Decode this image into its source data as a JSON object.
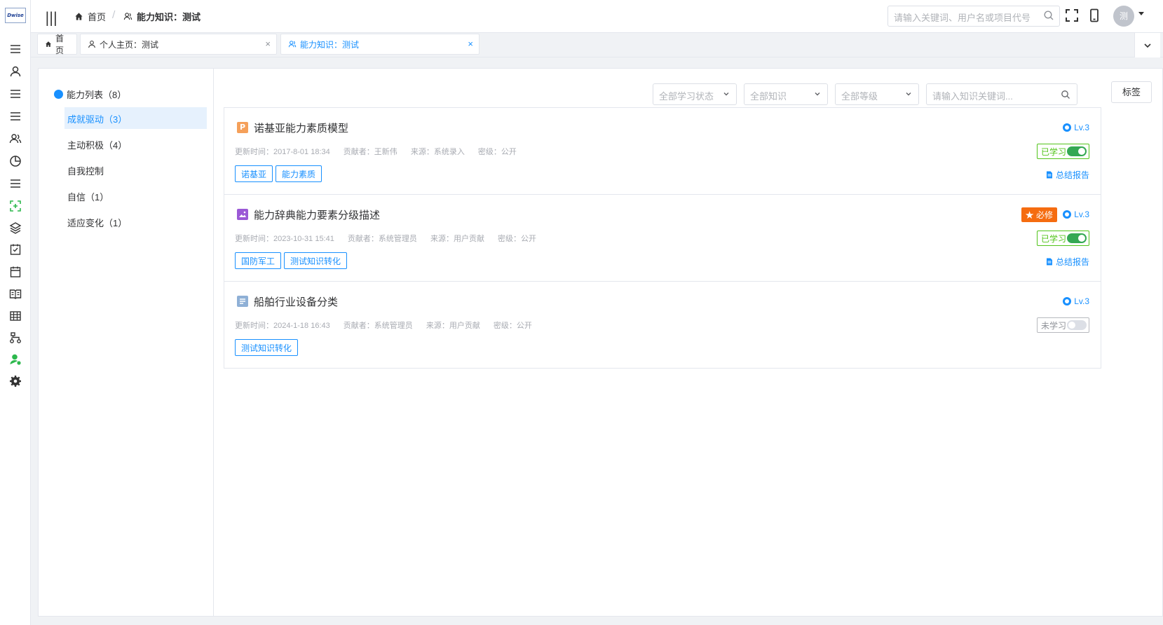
{
  "app": {
    "logo": "Dwise"
  },
  "header": {
    "breadcrumb_home": "首页",
    "breadcrumb_sep": "/",
    "breadcrumb_current": "能力知识：测试",
    "search_placeholder": "请输入关键词、用户名或项目代号",
    "avatar_text": "测"
  },
  "tabs": [
    {
      "label": "首页",
      "icon": "home-icon"
    },
    {
      "label": "个人主页：测试",
      "icon": "user-icon",
      "close": "×"
    },
    {
      "label": "能力知识：测试",
      "icon": "users-icon",
      "close": "×",
      "active": true
    }
  ],
  "sidebar": {
    "root": "能力列表（8）",
    "items": [
      {
        "label": "成就驱动（3）",
        "selected": true
      },
      {
        "label": "主动积极（4）"
      },
      {
        "label": "自我控制"
      },
      {
        "label": "自信（1）"
      },
      {
        "label": "适应变化（1）"
      }
    ]
  },
  "filters": {
    "study_status": "全部学习状态",
    "knowledge": "全部知识",
    "level": "全部等级",
    "keyword_placeholder": "请输入知识关键词...",
    "tag_button": "标签"
  },
  "cards": [
    {
      "icon_letter": "P",
      "icon_color": "#f5a05a",
      "title": "诺基亚能力素质模型",
      "update_time": "更新时间：2017-8-01 18:34",
      "contributor": "贡献者：王新伟",
      "source": "来源：系统录入",
      "secrecy": "密级：公开",
      "tags": [
        "诺基亚",
        "能力素质"
      ],
      "level": "Lv.3",
      "status": "已学习",
      "learned": true,
      "report": "总结报告"
    },
    {
      "icon_color": "#9b59d6",
      "title": "能力辞典能力要素分级描述",
      "update_time": "更新时间：2023-10-31 15:41",
      "contributor": "贡献者：系统管理员",
      "source": "来源：用户贡献",
      "secrecy": "密级：公开",
      "tags": [
        "国防军工",
        "测试知识转化"
      ],
      "required": "★ 必修",
      "level": "Lv.3",
      "status": "已学习",
      "learned": true,
      "report": "总结报告"
    },
    {
      "icon_color": "#8fb0d6",
      "title": "船舶行业设备分类",
      "update_time": "更新时间：2024-1-18 16:43",
      "contributor": "贡献者：系统管理员",
      "source": "来源：用户贡献",
      "secrecy": "密级：公开",
      "tags": [
        "测试知识转化"
      ],
      "level": "Lv.3",
      "status": "未学习",
      "learned": false
    }
  ]
}
